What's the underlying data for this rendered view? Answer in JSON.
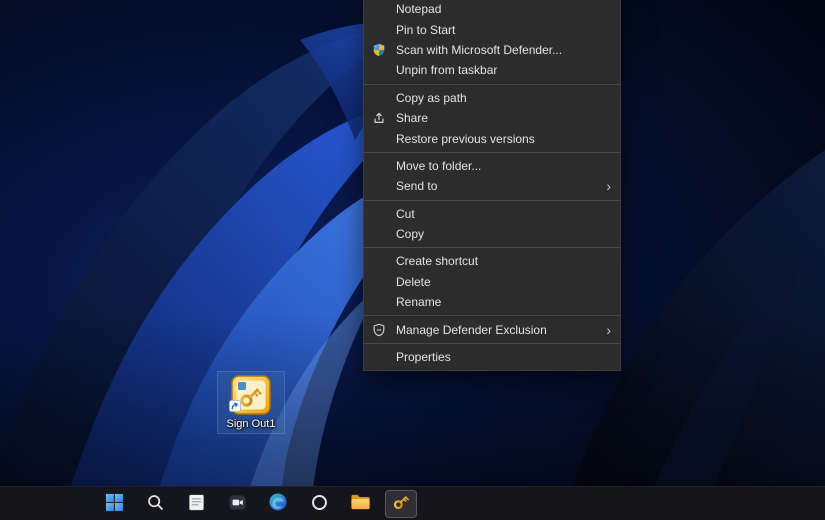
{
  "context_menu": {
    "submenu_arrow": "›",
    "items": [
      {
        "label": "Notepad"
      },
      {
        "label": "Pin to Start"
      },
      {
        "label": "Scan with Microsoft Defender...",
        "icon": "defender-shield-icon"
      },
      {
        "label": "Unpin from taskbar"
      },
      {
        "label": "Copy as path"
      },
      {
        "label": "Share",
        "icon": "share-icon"
      },
      {
        "label": "Restore previous versions"
      },
      {
        "label": "Move to folder..."
      },
      {
        "label": "Send to",
        "submenu": true
      },
      {
        "label": "Cut"
      },
      {
        "label": "Copy"
      },
      {
        "label": "Create shortcut"
      },
      {
        "label": "Delete"
      },
      {
        "label": "Rename"
      },
      {
        "label": "Manage Defender Exclusion",
        "icon": "defender-exclusion-icon",
        "submenu": true
      },
      {
        "label": "Properties"
      }
    ]
  },
  "desktop": {
    "shortcut_label": "Sign Out1"
  },
  "taskbar": {
    "icons": [
      {
        "name": "start"
      },
      {
        "name": "search"
      },
      {
        "name": "notepad-app"
      },
      {
        "name": "chat-camera-app"
      },
      {
        "name": "edge-browser"
      },
      {
        "name": "ring-app"
      },
      {
        "name": "file-explorer"
      },
      {
        "name": "sign-out-key",
        "active": true
      }
    ]
  },
  "colors": {
    "menu_background": "#2c2c2c",
    "menu_text": "#e4e4e4",
    "taskbar_background": "#16161b",
    "wallpaper_accent": "#2f6bff",
    "key_gold": "#e9a511"
  }
}
